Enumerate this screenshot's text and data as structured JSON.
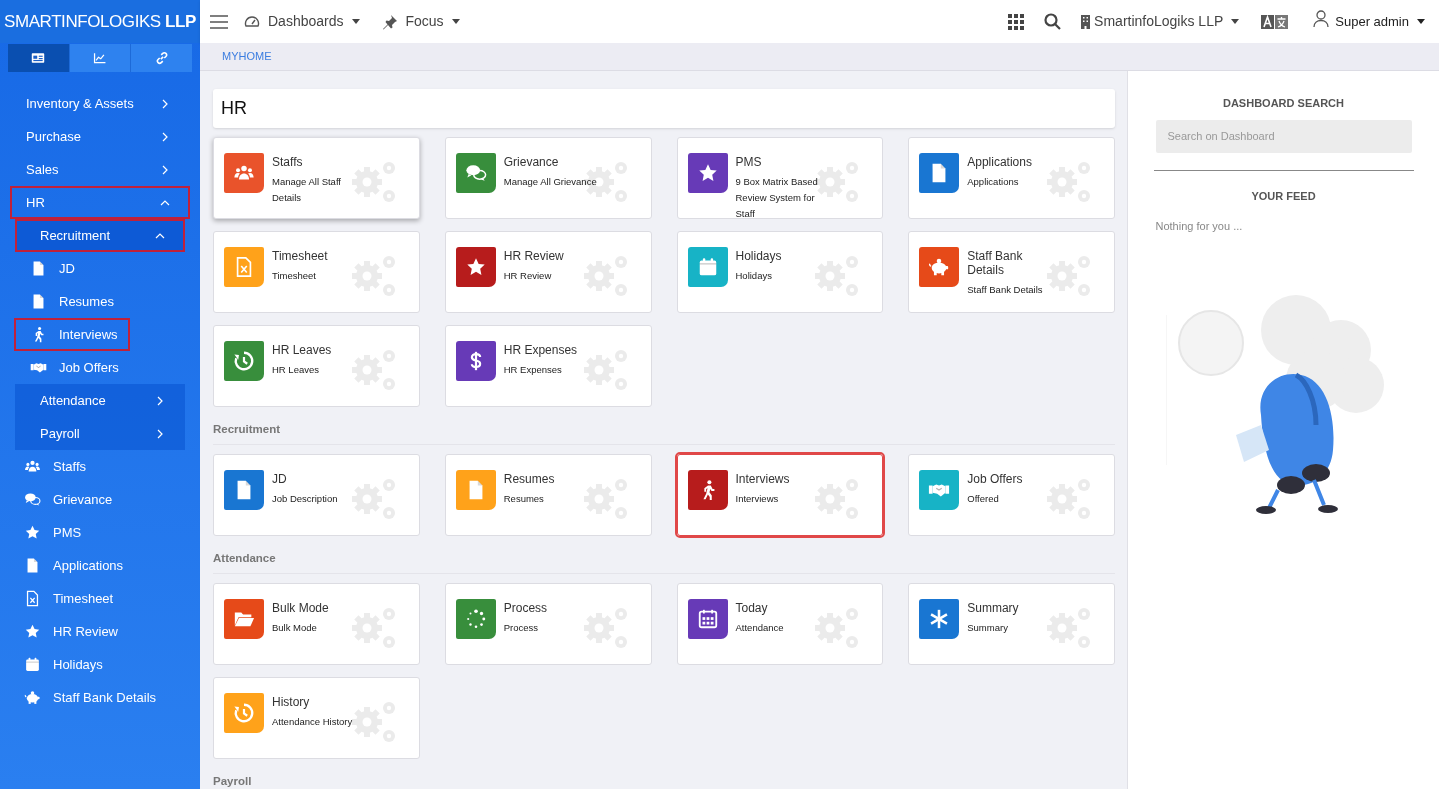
{
  "brand": {
    "name": "SMARTINFOLOGIKS",
    "suffix": "LLP"
  },
  "sidebar": {
    "tabs": [
      {
        "selected": true
      },
      {
        "selected": false
      },
      {
        "selected": false
      }
    ],
    "items": [
      {
        "label": "Inventory & Assets",
        "expanded": false,
        "highlighted": false
      },
      {
        "label": "Purchase",
        "expanded": false,
        "highlighted": false
      },
      {
        "label": "Sales",
        "expanded": false,
        "highlighted": false
      },
      {
        "label": "HR",
        "expanded": true,
        "highlighted": true,
        "children": [
          {
            "label": "Recruitment",
            "expanded": true,
            "highlighted": true,
            "children": [
              {
                "label": "JD",
                "highlighted": false
              },
              {
                "label": "Resumes",
                "highlighted": false
              },
              {
                "label": "Interviews",
                "highlighted": true
              },
              {
                "label": "Job Offers",
                "highlighted": false
              }
            ]
          },
          {
            "label": "Attendance",
            "expanded": false,
            "highlighted": false
          },
          {
            "label": "Payroll",
            "expanded": false,
            "highlighted": false
          },
          {
            "label": "Staffs",
            "highlighted": false
          },
          {
            "label": "Grievance",
            "highlighted": false
          },
          {
            "label": "PMS",
            "highlighted": false
          },
          {
            "label": "Applications",
            "highlighted": false
          },
          {
            "label": "Timesheet",
            "highlighted": false
          },
          {
            "label": "HR Review",
            "highlighted": false
          },
          {
            "label": "Holidays",
            "highlighted": false
          },
          {
            "label": "Staff Bank Details",
            "highlighted": false
          }
        ]
      }
    ]
  },
  "topbar": {
    "menus": [
      "Dashboards",
      "Focus"
    ],
    "company": "SmartinfoLogiks LLP",
    "user": "Super admin"
  },
  "breadcrumb": "MYHOME",
  "sections": [
    {
      "title": "HR",
      "kind": "box",
      "tiles": [
        {
          "title": "Staffs",
          "subtitle": "Manage All Staff Details",
          "color": "#e9532b",
          "hovered": true,
          "highlighted": false
        },
        {
          "title": "Grievance",
          "subtitle": "Manage All Grievance",
          "color": "#388e3c",
          "hovered": false,
          "highlighted": false
        },
        {
          "title": "PMS",
          "subtitle": "9 Box Matrix Based Review System for Staff",
          "color": "#673ab7",
          "hovered": false,
          "highlighted": false
        },
        {
          "title": "Applications",
          "subtitle": "Applications",
          "color": "#1976d2",
          "hovered": false,
          "highlighted": false
        },
        {
          "title": "Timesheet",
          "subtitle": "Timesheet",
          "color": "#ffa21a",
          "hovered": false,
          "highlighted": false
        },
        {
          "title": "HR Review",
          "subtitle": "HR Review",
          "color": "#b71c1c",
          "hovered": false,
          "highlighted": false
        },
        {
          "title": "Holidays",
          "subtitle": "Holidays",
          "color": "#17b3c6",
          "hovered": false,
          "highlighted": false
        },
        {
          "title": "Staff Bank Details",
          "subtitle": "Staff Bank Details",
          "color": "#e64a19",
          "hovered": false,
          "highlighted": false
        },
        {
          "title": "HR Leaves",
          "subtitle": "HR Leaves",
          "color": "#388e3c",
          "hovered": false,
          "highlighted": false
        },
        {
          "title": "HR Expenses",
          "subtitle": "HR Expenses",
          "color": "#673ab7",
          "hovered": false,
          "highlighted": false
        }
      ]
    },
    {
      "title": "Recruitment",
      "kind": "label",
      "tiles": [
        {
          "title": "JD",
          "subtitle": "Job Description",
          "color": "#1976d2",
          "hovered": false,
          "highlighted": false
        },
        {
          "title": "Resumes",
          "subtitle": "Resumes",
          "color": "#ffa21a",
          "hovered": false,
          "highlighted": false
        },
        {
          "title": "Interviews",
          "subtitle": "Interviews",
          "color": "#b71c1c",
          "hovered": false,
          "highlighted": true
        },
        {
          "title": "Job Offers",
          "subtitle": "Offered",
          "color": "#17b3c6",
          "hovered": false,
          "highlighted": false
        }
      ]
    },
    {
      "title": "Attendance",
      "kind": "label",
      "tiles": [
        {
          "title": "Bulk Mode",
          "subtitle": "Bulk Mode",
          "color": "#e64a19",
          "hovered": false,
          "highlighted": false
        },
        {
          "title": "Process",
          "subtitle": "Process",
          "color": "#388e3c",
          "hovered": false,
          "highlighted": false
        },
        {
          "title": "Today",
          "subtitle": "Attendance",
          "color": "#673ab7",
          "hovered": false,
          "highlighted": false
        },
        {
          "title": "Summary",
          "subtitle": "Summary",
          "color": "#1976d2",
          "hovered": false,
          "highlighted": false
        },
        {
          "title": "History",
          "subtitle": "Attendance History",
          "color": "#ffa21a",
          "hovered": false,
          "highlighted": false
        }
      ]
    },
    {
      "title": "Payroll",
      "kind": "label"
    }
  ],
  "right_panel": {
    "search_title": "DASHBOARD SEARCH",
    "search": {
      "placeholder": "Search on Dashboard"
    },
    "feed_title": "YOUR FEED",
    "feed_empty": "Nothing for you ..."
  }
}
